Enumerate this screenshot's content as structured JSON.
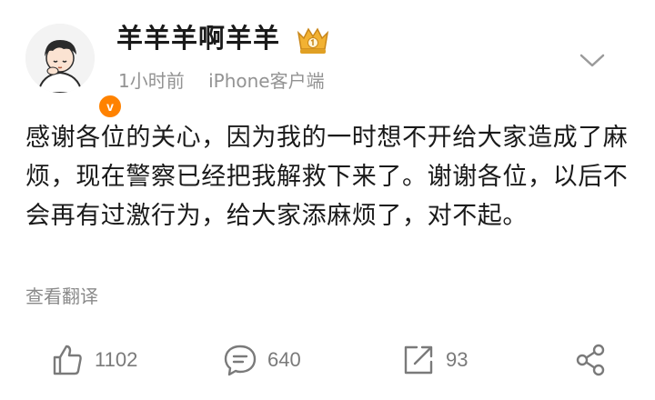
{
  "user": {
    "name": "羊羊羊啊羊羊",
    "verified_mark": "v",
    "avatar_icon": "avatar-cartoon-boy",
    "badge_icon": "crown-level-badge"
  },
  "meta": {
    "time": "1小时前",
    "source": "iPhone客户端"
  },
  "post": {
    "text": "感谢各位的关心，因为我的一时想不开给大家造成了麻烦，现在警察已经把我解救下来了。谢谢各位，以后不会再有过激行为，给大家添麻烦了，对不起。",
    "translate_label": "查看翻译"
  },
  "actions": {
    "like_count": "1102",
    "comment_count": "640",
    "repost_count": "93"
  },
  "colors": {
    "text": "#1a1a1a",
    "meta": "#939393",
    "icon": "#7a7a7a",
    "verified": "#ff8200",
    "badge": "#f2b233"
  }
}
